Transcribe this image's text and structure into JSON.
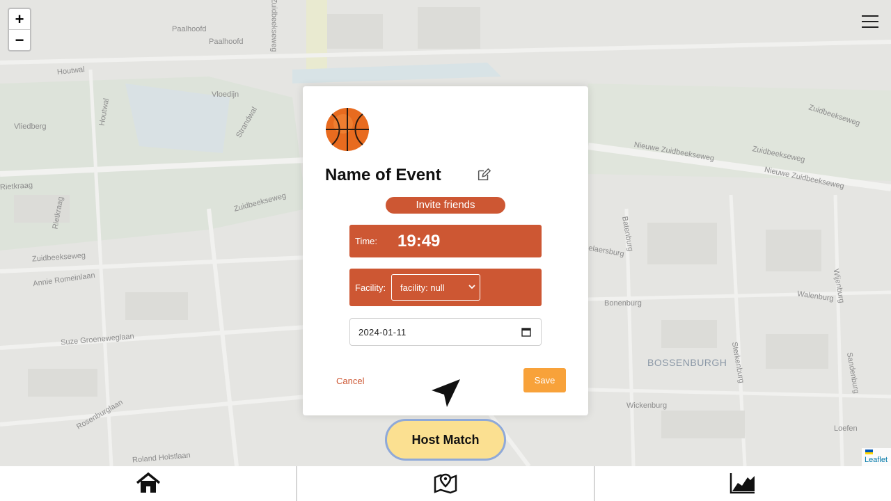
{
  "map": {
    "labels": [
      "Paalhoofd",
      "Paalhoofd",
      "Houtwal",
      "Vloedijn",
      "Vliedberg",
      "Houtwal",
      "Strandwal",
      "Rietkraag",
      "Zuidbeekseweg",
      "Zuidbeekseweg",
      "Annie Romeinlaan",
      "Suze Groeneweglaan",
      "Rosenburglaan",
      "Roland Holstlaan",
      "Zuidbeekseweg",
      "Nieuwe Zuidbeekseweg",
      "Nieuwe Zuidbeekseweg",
      "Zuidbeekseweg",
      "Batenburg",
      "elaersburg",
      "Bonenburg",
      "Walenburg",
      "Wijenburg",
      "Sterkenburg",
      "Sandenburg",
      "Wickenburg",
      "Loefen",
      "Zuidbeekseweg",
      "Rietkraag"
    ],
    "district": "BOSSENBURGH",
    "attribution": "Leaflet"
  },
  "zoom": {
    "in_label": "+",
    "out_label": "−"
  },
  "modal": {
    "title": "Name of Event",
    "invite_label": "Invite friends",
    "time_label": "Time:",
    "time_value": "19:49",
    "facility_label": "Facility:",
    "facility_value": "facility: null",
    "date_value": "2024-01-11",
    "cancel_label": "Cancel",
    "save_label": "Save"
  },
  "host_button_label": "Host Match",
  "colors": {
    "accent": "#cd5733",
    "save": "#f8a23a",
    "host_bg": "#fbe091",
    "host_border": "#8fa9d8"
  },
  "icons": [
    "menu-icon",
    "basketball-icon",
    "edit-icon",
    "chevron-down-icon",
    "calendar-icon",
    "navigation-arrow-icon",
    "home-icon",
    "map-pin-icon",
    "chart-icon"
  ]
}
